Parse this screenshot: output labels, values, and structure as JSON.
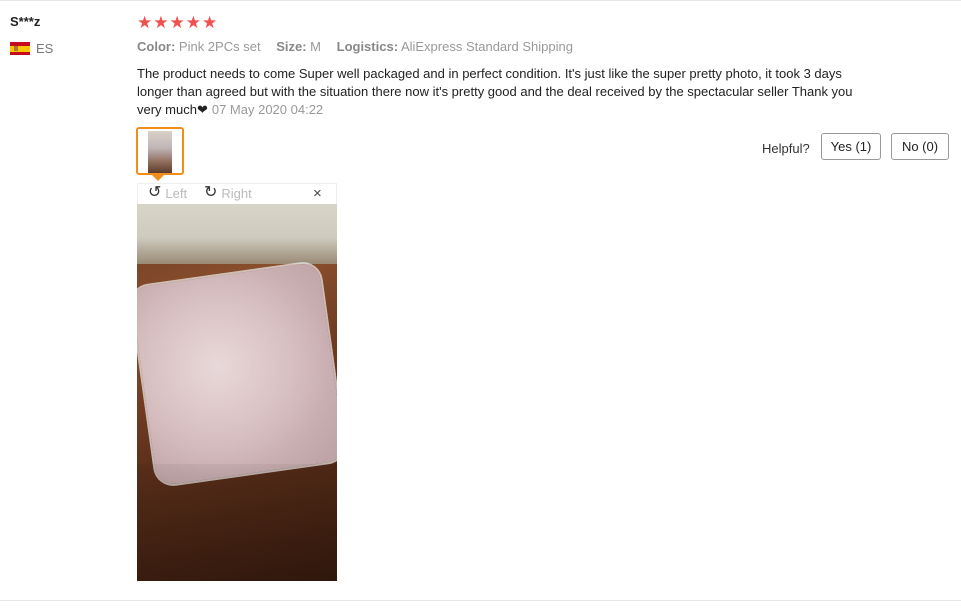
{
  "user": {
    "name": "S***z",
    "country_code": "ES"
  },
  "review": {
    "rating": 5,
    "color_label": "Color:",
    "color_value": "Pink 2PCs set",
    "size_label": "Size:",
    "size_value": "M",
    "logistics_label": "Logistics:",
    "logistics_value": "AliExpress Standard Shipping",
    "text": "The product needs to come Super well packaged and in perfect condition. It's just like the super pretty photo, it took 3 days longer than agreed but with the situation there now it's pretty good and the deal received by the spectacular seller Thank you very much❤",
    "date": "07 May 2020 04:22"
  },
  "viewer": {
    "left_label": "Left",
    "right_label": "Right",
    "close_icon": "×"
  },
  "helpful": {
    "label": "Helpful?",
    "yes_label": "Yes (1)",
    "no_label": "No (0)"
  },
  "colors": {
    "star": "#f0504e",
    "thumb_border": "#f28c1a"
  }
}
